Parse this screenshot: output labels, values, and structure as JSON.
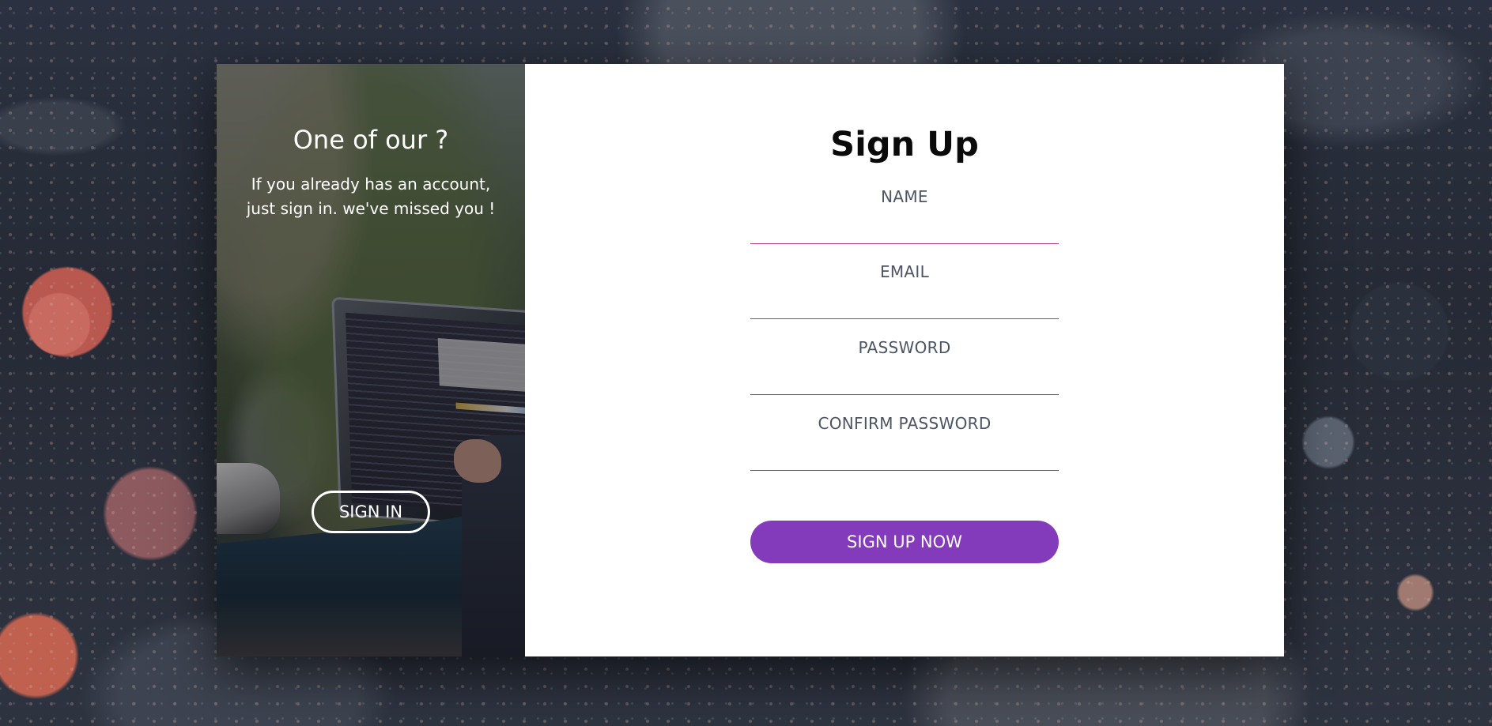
{
  "theme": {
    "accent": "#843bbb",
    "underline": "#b03a73",
    "label_color": "#4b5563"
  },
  "left": {
    "title": "One of our ?",
    "text": "If you already has an account, just sign in. we've missed you !",
    "signin_label": "SIGN IN"
  },
  "form": {
    "title": "Sign Up",
    "fields": [
      {
        "label": "NAME",
        "value": ""
      },
      {
        "label": "EMAIL",
        "value": ""
      },
      {
        "label": "PASSWORD",
        "value": ""
      },
      {
        "label": "CONFIRM PASSWORD",
        "value": ""
      }
    ],
    "submit_label": "SIGN UP NOW"
  }
}
